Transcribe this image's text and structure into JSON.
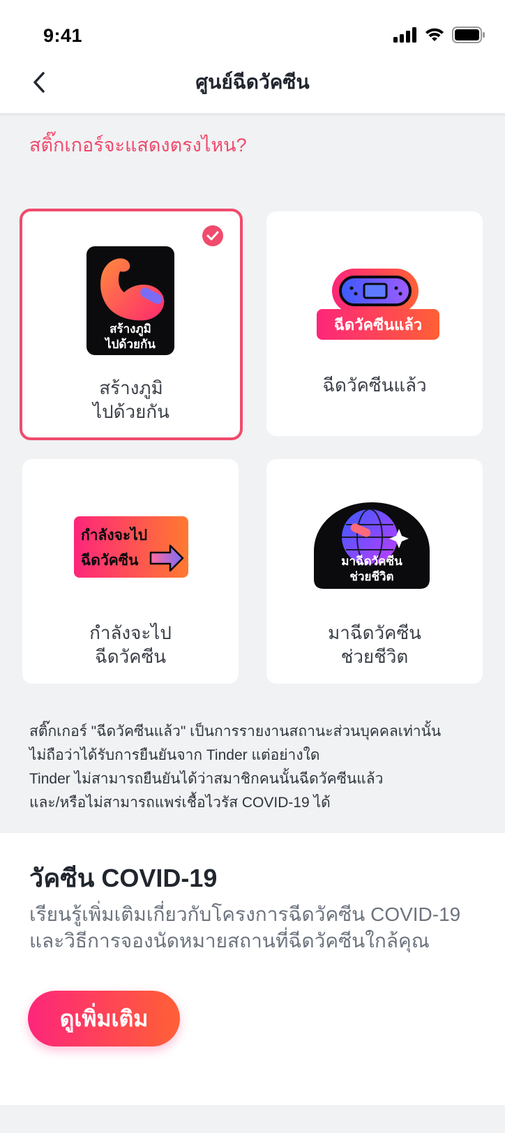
{
  "status_bar": {
    "time": "9:41"
  },
  "nav": {
    "title": "ศูนย์ฉีดวัคซีน"
  },
  "question": "สติ๊กเกอร์จะแสดงตรงไหน?",
  "stickers": [
    {
      "label_line1": "สร้างภูมิ",
      "label_line2": "ไปด้วยกัน",
      "art_line1": "สร้างภูมิ",
      "art_line2": "ไปด้วยกัน",
      "selected": true
    },
    {
      "label_line1": "ฉีดวัคซีนแล้ว",
      "label_line2": "",
      "art_line1": "ฉีดวัคซีนแล้ว",
      "art_line2": "",
      "selected": false
    },
    {
      "label_line1": "กำลังจะไป",
      "label_line2": "ฉีดวัคซีน",
      "art_line1": "กำลังจะไป",
      "art_line2": "ฉีดวัคซีน",
      "selected": false
    },
    {
      "label_line1": "มาฉีดวัคซีน",
      "label_line2": "ช่วยชีวิต",
      "art_line1": "มาฉีดวัคซีน",
      "art_line2": "ช่วยชีวิต",
      "selected": false
    }
  ],
  "disclaimer": {
    "line1": "สติ๊กเกอร์ \"ฉีดวัคซีนแล้ว\" เป็นการรายงานสถานะส่วนบุคคลเท่านั้น",
    "line2": "ไม่ถือว่าได้รับการยืนยันจาก Tinder แต่อย่างใด",
    "line3": "Tinder ไม่สามารถยืนยันได้ว่าสมาชิกคนนั้นฉีดวัคซีนแล้ว",
    "line4": "และ/หรือไม่สามารถแพร่เชื้อไวรัส COVID-19 ได้"
  },
  "covid": {
    "title": "วัคซีน COVID-19",
    "desc_line1": "เรียนรู้เพิ่มเติมเกี่ยวกับโครงการฉีดวัคซีน COVID-19",
    "desc_line2": "และวิธีการจองนัดหมายสถานที่ฉีดวัคซีนใกล้คุณ",
    "button_label": "ดูเพิ่มเติม"
  },
  "colors": {
    "accent": "#f04b6c",
    "gradient_start": "#fd267a",
    "gradient_end": "#ff6036",
    "background": "#f0f2f4"
  }
}
